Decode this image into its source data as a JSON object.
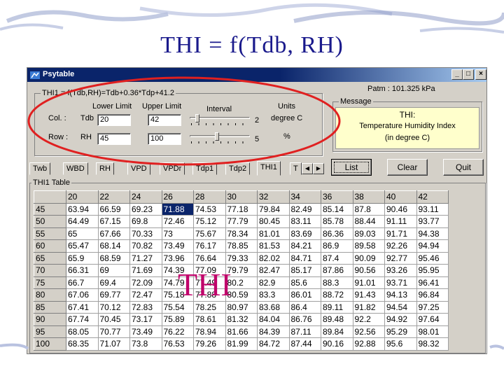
{
  "slide_title": "THI = f(Tdb, RH)",
  "overlay_label": "THI",
  "window": {
    "title": "Psytable",
    "min": "_",
    "max": "□",
    "close": "×"
  },
  "thi_group": {
    "title": "THI1 = f(Tdb,RH)=Tdb+0.36*Tdp+41.2",
    "lower_limit": "Lower Limit",
    "upper_limit": "Upper Limit",
    "interval": "Interval",
    "units": "Units",
    "col_label": "Col. :",
    "col_var": "Tdb",
    "col_lower": "20",
    "col_upper": "42",
    "col_interval": "2",
    "col_unit": "degree C",
    "row_label": "Row :",
    "row_var": "RH",
    "row_lower": "45",
    "row_upper": "100",
    "row_interval": "5",
    "row_unit": "%",
    "col_slider_level": 0.1,
    "row_slider_level": 0.45
  },
  "patm": "Patm : 101.325 kPa",
  "message": {
    "title": "Message",
    "line1": "THI:",
    "line2": "Temperature Humidity Index",
    "line3": "(in degree C)"
  },
  "tabs": [
    "Twb",
    "WBD",
    "RH",
    "VPD",
    "VPDr",
    "Tdp1",
    "Tdp2",
    "THI1",
    "T"
  ],
  "active_tab": "THI1",
  "buttons": {
    "list": "List",
    "clear": "Clear",
    "quit": "Quit"
  },
  "table": {
    "title": "THI1 Table",
    "columns": [
      "20",
      "22",
      "24",
      "26",
      "28",
      "30",
      "32",
      "34",
      "36",
      "38",
      "40",
      "42"
    ],
    "rows": [
      {
        "rh": "45",
        "values": [
          "63.94",
          "66.59",
          "69.23",
          "71.88",
          "74.53",
          "77.18",
          "79.84",
          "82.49",
          "85.14",
          "87.8",
          "90.46",
          "93.11"
        ]
      },
      {
        "rh": "50",
        "values": [
          "64.49",
          "67.15",
          "69.8",
          "72.46",
          "75.12",
          "77.79",
          "80.45",
          "83.11",
          "85.78",
          "88.44",
          "91.11",
          "93.77"
        ]
      },
      {
        "rh": "55",
        "values": [
          "65",
          "67.66",
          "70.33",
          "73",
          "75.67",
          "78.34",
          "81.01",
          "83.69",
          "86.36",
          "89.03",
          "91.71",
          "94.38"
        ]
      },
      {
        "rh": "60",
        "values": [
          "65.47",
          "68.14",
          "70.82",
          "73.49",
          "76.17",
          "78.85",
          "81.53",
          "84.21",
          "86.9",
          "89.58",
          "92.26",
          "94.94"
        ]
      },
      {
        "rh": "65",
        "values": [
          "65.9",
          "68.59",
          "71.27",
          "73.96",
          "76.64",
          "79.33",
          "82.02",
          "84.71",
          "87.4",
          "90.09",
          "92.77",
          "95.46"
        ]
      },
      {
        "rh": "70",
        "values": [
          "66.31",
          "69",
          "71.69",
          "74.39",
          "77.09",
          "79.79",
          "82.47",
          "85.17",
          "87.86",
          "90.56",
          "93.26",
          "95.95"
        ]
      },
      {
        "rh": "75",
        "values": [
          "66.7",
          "69.4",
          "72.09",
          "74.79",
          "77.49",
          "80.2",
          "82.9",
          "85.6",
          "88.3",
          "91.01",
          "93.71",
          "96.41"
        ]
      },
      {
        "rh": "80",
        "values": [
          "67.06",
          "69.77",
          "72.47",
          "75.18",
          "77.88",
          "80.59",
          "83.3",
          "86.01",
          "88.72",
          "91.43",
          "94.13",
          "96.84"
        ]
      },
      {
        "rh": "85",
        "values": [
          "67.41",
          "70.12",
          "72.83",
          "75.54",
          "78.25",
          "80.97",
          "83.68",
          "86.4",
          "89.11",
          "91.82",
          "94.54",
          "97.25"
        ]
      },
      {
        "rh": "90",
        "values": [
          "67.74",
          "70.45",
          "73.17",
          "75.89",
          "78.61",
          "81.32",
          "84.04",
          "86.76",
          "89.48",
          "92.2",
          "94.92",
          "97.64"
        ]
      },
      {
        "rh": "95",
        "values": [
          "68.05",
          "70.77",
          "73.49",
          "76.22",
          "78.94",
          "81.66",
          "84.39",
          "87.11",
          "89.84",
          "92.56",
          "95.29",
          "98.01"
        ]
      },
      {
        "rh": "100",
        "values": [
          "68.35",
          "71.07",
          "73.8",
          "76.53",
          "79.26",
          "81.99",
          "84.72",
          "87.44",
          "90.16",
          "92.88",
          "95.6",
          "98.32"
        ]
      }
    ],
    "selected_cell": "71.88"
  },
  "colors": {
    "title_text": "#1a1a8c",
    "overlay": "#c0006a",
    "ellipse": "#e02020",
    "selection": "#0a246a"
  }
}
